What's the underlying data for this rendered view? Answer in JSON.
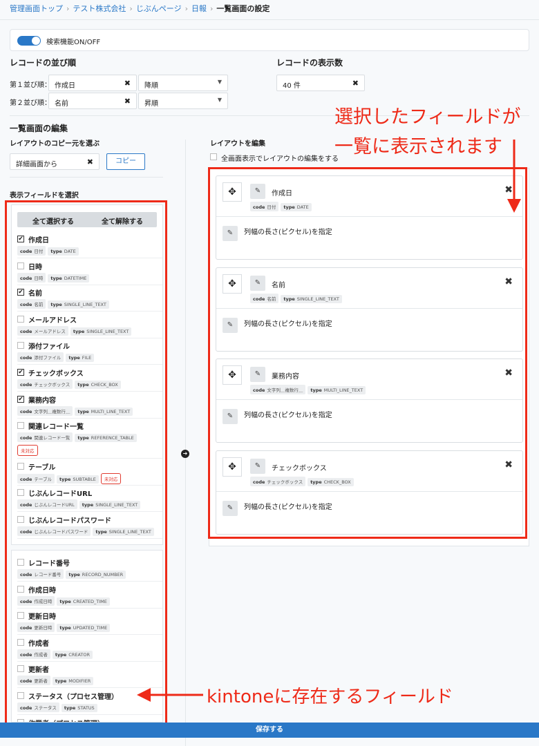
{
  "breadcrumb": {
    "items": [
      "管理画面トップ",
      "テスト株式会社",
      "じぶんページ",
      "日報"
    ],
    "current": "一覧画面の設定"
  },
  "toggle": {
    "label": "検索機能ON/OFF",
    "on": true
  },
  "sort": {
    "title": "レコードの並び順",
    "rows": [
      {
        "label": "第１並び順：",
        "field": "作成日",
        "order": "降順"
      },
      {
        "label": "第２並び順：",
        "field": "名前",
        "order": "昇順"
      }
    ]
  },
  "display_count": {
    "title": "レコードの表示数",
    "value": "40 件"
  },
  "list_edit": {
    "title": "一覧画面の編集",
    "copy_source_label": "レイアウトのコピー元を選ぶ",
    "copy_source_value": "詳細画面から",
    "copy_button": "コピー",
    "select_fields_label": "表示フィールドを選択",
    "select_all": "全て選択する",
    "deselect_all": "全て解除する"
  },
  "fields": [
    {
      "name": "作成日",
      "checked": true,
      "code": "日付",
      "type": "DATE"
    },
    {
      "name": "日時",
      "checked": false,
      "code": "日時",
      "type": "DATETIME"
    },
    {
      "name": "名前",
      "checked": true,
      "code": "名前",
      "type": "SINGLE_LINE_TEXT"
    },
    {
      "name": "メールアドレス",
      "checked": false,
      "code": "メールアドレス",
      "type": "SINGLE_LINE_TEXT"
    },
    {
      "name": "添付ファイル",
      "checked": false,
      "code": "添付ファイル",
      "type": "FILE"
    },
    {
      "name": "チェックボックス",
      "checked": true,
      "code": "チェックボックス",
      "type": "CHECK_BOX"
    },
    {
      "name": "業務内容",
      "checked": true,
      "code": "文字列＿複数行＿",
      "type": "MULTI_LINE_TEXT"
    },
    {
      "name": "関連レコード一覧",
      "checked": false,
      "code": "関連レコード一覧",
      "type": "REFERENCE_TABLE",
      "badge": "未対応"
    },
    {
      "name": "テーブル",
      "checked": false,
      "code": "テーブル",
      "type": "SUBTABLE",
      "badge_inline": "未対応"
    },
    {
      "name": "じぶんレコードURL",
      "checked": false,
      "code": "じぶんレコードURL",
      "type": "SINGLE_LINE_TEXT"
    },
    {
      "name": "じぶんレコードパスワード",
      "checked": false,
      "code": "じぶんレコードパスワード",
      "type": "SINGLE_LINE_TEXT"
    }
  ],
  "system_fields": [
    {
      "name": "レコード番号",
      "checked": false,
      "code": "レコード番号",
      "type": "RECORD_NUMBER"
    },
    {
      "name": "作成日時",
      "checked": false,
      "code": "作成日時",
      "type": "CREATED_TIME"
    },
    {
      "name": "更新日時",
      "checked": false,
      "code": "更新日時",
      "type": "UPDATED_TIME"
    },
    {
      "name": "作成者",
      "checked": false,
      "code": "作成者",
      "type": "CREATOR"
    },
    {
      "name": "更新者",
      "checked": false,
      "code": "更新者",
      "type": "MODIFIER"
    },
    {
      "name": "ステータス（プロセス管理）",
      "checked": false,
      "code": "ステータス",
      "type": "STATUS"
    },
    {
      "name": "作業者（プロセス管理）",
      "checked": false
    }
  ],
  "layout_edit": {
    "title": "レイアウトを編集",
    "fullscreen_label": "全画面表示でレイアウトの編集をする",
    "width_label": "列幅の長さ(ピクセル)を指定",
    "cards": [
      {
        "name": "作成日",
        "code": "日付",
        "type": "DATE"
      },
      {
        "name": "名前",
        "code": "名前",
        "type": "SINGLE_LINE_TEXT"
      },
      {
        "name": "業務内容",
        "code": "文字列＿複数行＿",
        "type": "MULTI_LINE_TEXT"
      },
      {
        "name": "チェックボックス",
        "code": "チェックボックス",
        "type": "CHECK_BOX"
      }
    ]
  },
  "labels": {
    "code": "code",
    "type": "type"
  },
  "annotations": {
    "right_line1": "選択したフィールドが",
    "right_line2": "一覧に表示されます",
    "bottom": "kintoneに存在するフィールド"
  },
  "save_button": "保存する",
  "colors": {
    "accent": "#2a78c7",
    "annotation_red": "#ee2a18"
  }
}
